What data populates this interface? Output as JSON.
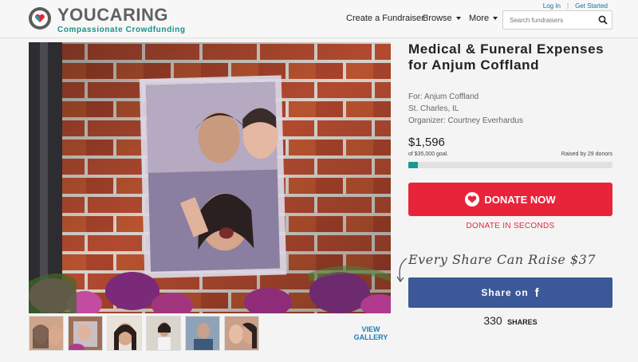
{
  "header": {
    "logo": {
      "brand_you": "YOU",
      "brand_caring": "CARING",
      "tagline": "Compassionate Crowdfunding"
    },
    "top_links": {
      "login": "Log In",
      "get_started": "Get Started"
    },
    "nav": {
      "create": "Create a Fundraiser",
      "browse": "Browse",
      "more": "More"
    },
    "search": {
      "placeholder": "Search fundraisers",
      "value": ""
    }
  },
  "campaign": {
    "title": "Medical & Funeral Expenses for Anjum Coffland",
    "for_line": "For: Anjum Coffland",
    "location": "St. Charles, IL",
    "organizer_line": "Organizer: Courtney Everhardus",
    "amount": "$1,596",
    "goal_text": "of $35,000 goal.",
    "raised_by": "Raised by 29 donors",
    "progress_fraction": 0.046
  },
  "actions": {
    "donate_label": "DONATE NOW",
    "donate_sub": "DONATE IN SECONDS",
    "share_promo": "Every Share Can Raise $37",
    "share_label": "Share on",
    "share_icon": "f",
    "shares_count": "330",
    "shares_label": "SHARES"
  },
  "gallery": {
    "view_label": "VIEW GALLERY",
    "thumbnails": [
      "photo-1",
      "photo-2",
      "photo-3",
      "photo-4",
      "photo-5",
      "photo-6"
    ]
  },
  "colors": {
    "accent_teal": "#1a9a8f",
    "donate_red": "#e8243a",
    "facebook_blue": "#3b5898",
    "link_blue": "#1a7fb8"
  }
}
